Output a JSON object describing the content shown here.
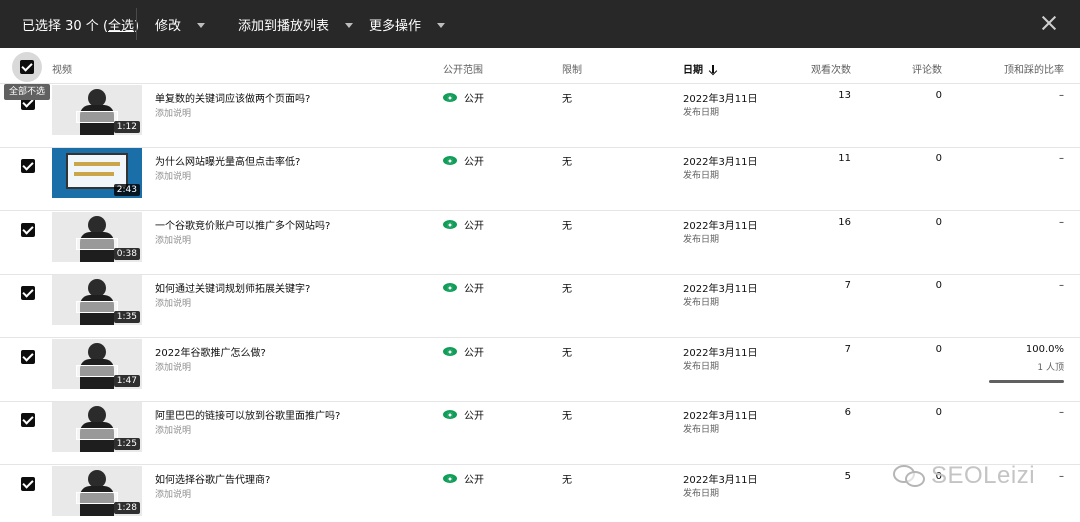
{
  "topbar": {
    "selected_prefix": "已选择 30 个 (",
    "select_all": "全选",
    "selected_suffix": ")",
    "menu_edit": "修改",
    "menu_add_playlist": "添加到播放列表",
    "menu_more": "更多操作"
  },
  "header": {
    "video": "视频",
    "visibility": "公开范围",
    "restrictions": "限制",
    "date": "日期",
    "views": "观看次数",
    "comments": "评论数",
    "like_ratio": "顶和踩的比率",
    "deselect_tooltip": "全部不选"
  },
  "rows": [
    {
      "title": "单复数的关键词应该做两个页面吗?",
      "desc": "添加说明",
      "duration": "1:12",
      "visibility": "公开",
      "restriction": "无",
      "date": "2022年3月11日",
      "date_sub": "发布日期",
      "views": "13",
      "comments": "0",
      "ratio": "–"
    },
    {
      "title": "为什么网站曝光量高但点击率低?",
      "desc": "添加说明",
      "duration": "2:43",
      "visibility": "公开",
      "restriction": "无",
      "date": "2022年3月11日",
      "date_sub": "发布日期",
      "views": "11",
      "comments": "0",
      "ratio": "–"
    },
    {
      "title": "一个谷歌竞价账户可以推广多个网站吗?",
      "desc": "添加说明",
      "duration": "0:38",
      "visibility": "公开",
      "restriction": "无",
      "date": "2022年3月11日",
      "date_sub": "发布日期",
      "views": "16",
      "comments": "0",
      "ratio": "–"
    },
    {
      "title": "如何通过关键词规划师拓展关键字?",
      "desc": "添加说明",
      "duration": "1:35",
      "visibility": "公开",
      "restriction": "无",
      "date": "2022年3月11日",
      "date_sub": "发布日期",
      "views": "7",
      "comments": "0",
      "ratio": "–"
    },
    {
      "title": "2022年谷歌推广怎么做?",
      "desc": "添加说明",
      "duration": "1:47",
      "visibility": "公开",
      "restriction": "无",
      "date": "2022年3月11日",
      "date_sub": "发布日期",
      "views": "7",
      "comments": "0",
      "ratio": "100.0%",
      "ratio_sub": "1 人顶",
      "ratio_fraction": 1.0
    },
    {
      "title": "阿里巴巴的链接可以放到谷歌里面推广吗?",
      "desc": "添加说明",
      "duration": "1:25",
      "visibility": "公开",
      "restriction": "无",
      "date": "2022年3月11日",
      "date_sub": "发布日期",
      "views": "6",
      "comments": "0",
      "ratio": "–"
    },
    {
      "title": "如何选择谷歌广告代理商?",
      "desc": "添加说明",
      "duration": "1:28",
      "visibility": "公开",
      "restriction": "无",
      "date": "2022年3月11日",
      "date_sub": "发布日期",
      "views": "5",
      "comments": "0",
      "ratio": "–"
    }
  ],
  "watermark": "SEOLeizi",
  "colors": {
    "topbar_bg": "#282828",
    "public_green": "#0f9d58"
  }
}
